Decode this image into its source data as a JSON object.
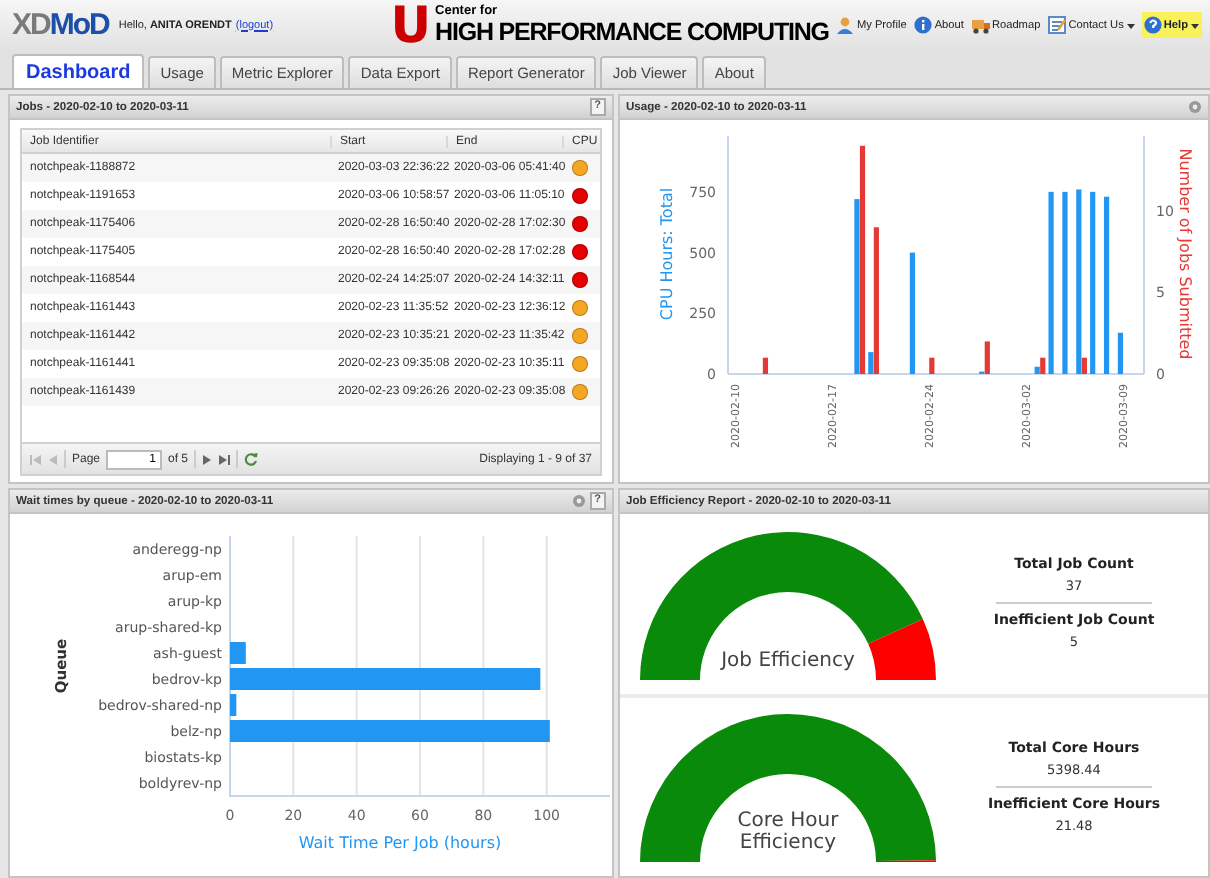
{
  "header": {
    "logo": {
      "part_1": "XD",
      "part_2": "MoD"
    },
    "greeting": "Hello, **ANITA ORENDT**",
    "logout": "(logout)",
    "center_logo": {
      "mark": "U",
      "line_1": "Center for",
      "line_2": "HIGH PERFORMANCE COMPUTING"
    },
    "toolbar": [
      {
        "label": "My Profile",
        "kind": "profile",
        "dropdown": false,
        "highlighted": false
      },
      {
        "label": "About",
        "kind": "info",
        "dropdown": false,
        "highlighted": false
      },
      {
        "label": "Roadmap",
        "kind": "truck",
        "dropdown": false,
        "highlighted": false
      },
      {
        "label": "Contact Us",
        "kind": "form",
        "dropdown": true,
        "highlighted": false
      },
      {
        "label": "Help",
        "kind": "help",
        "dropdown": true,
        "highlighted": true
      }
    ]
  },
  "tabs": [
    {
      "label": "Dashboard",
      "selected": true
    },
    {
      "label": "Usage",
      "selected": false
    },
    {
      "label": "Metric Explorer",
      "selected": false
    },
    {
      "label": "Data Export",
      "selected": false
    },
    {
      "label": "Report Generator",
      "selected": false
    },
    {
      "label": "Job Viewer",
      "selected": false
    },
    {
      "label": "About",
      "selected": false
    }
  ],
  "jobs_panel": {
    "title": "Jobs - 2020-02-10 to 2020-03-11",
    "help": "?",
    "columns": [
      "Job Identifier",
      "Start",
      "End",
      "CPU"
    ],
    "rows": [
      {
        "job": "notchpeak-1188872",
        "start": "2020-03-03 22:36:22",
        "end": "2020-03-06 05:41:40",
        "color": "#f5a623"
      },
      {
        "job": "notchpeak-1191653",
        "start": "2020-03-06 10:58:57",
        "end": "2020-03-06 11:05:10",
        "color": "#e60000"
      },
      {
        "job": "notchpeak-1175406",
        "start": "2020-02-28 16:50:40",
        "end": "2020-02-28 17:02:30",
        "color": "#e60000"
      },
      {
        "job": "notchpeak-1175405",
        "start": "2020-02-28 16:50:40",
        "end": "2020-02-28 17:02:28",
        "color": "#e60000"
      },
      {
        "job": "notchpeak-1168544",
        "start": "2020-02-24 14:25:07",
        "end": "2020-02-24 14:32:11",
        "color": "#e60000"
      },
      {
        "job": "notchpeak-1161443",
        "start": "2020-02-23 11:35:52",
        "end": "2020-02-23 12:36:12",
        "color": "#f5a623"
      },
      {
        "job": "notchpeak-1161442",
        "start": "2020-02-23 10:35:21",
        "end": "2020-02-23 11:35:42",
        "color": "#f5a623"
      },
      {
        "job": "notchpeak-1161441",
        "start": "2020-02-23 09:35:08",
        "end": "2020-02-23 10:35:11",
        "color": "#f5a623"
      },
      {
        "job": "notchpeak-1161439",
        "start": "2020-02-23 09:26:26",
        "end": "2020-02-23 09:35:08",
        "color": "#f5a623"
      }
    ],
    "pager": {
      "page_label": "Page",
      "page": "1",
      "of": "of 5",
      "displaying": "Displaying 1 - 9 of 37"
    }
  },
  "usage_panel": {
    "title": "Usage - 2020-02-10 to 2020-03-11",
    "chart_data": {
      "type": "bar",
      "categories": [
        "2020-02-10",
        null,
        null,
        null,
        null,
        null,
        null,
        "2020-02-17",
        null,
        null,
        null,
        null,
        null,
        null,
        "2020-02-24",
        null,
        null,
        null,
        null,
        null,
        null,
        "2020-03-02",
        null,
        null,
        null,
        null,
        null,
        null,
        "2020-03-09",
        null
      ],
      "ylim": [
        0,
        980
      ],
      "yticks": [
        0,
        250,
        500,
        750
      ],
      "y2lim": [
        0,
        14.6
      ],
      "y2ticks": [
        0,
        5,
        10
      ],
      "stacked": false,
      "series": [
        {
          "name": "CPU Hours: Total",
          "color": "#2196f3",
          "values": [
            null,
            null,
            null,
            null,
            null,
            null,
            null,
            null,
            null,
            720,
            90,
            null,
            null,
            500,
            null,
            null,
            null,
            null,
            10,
            null,
            null,
            null,
            30,
            750,
            750,
            760,
            750,
            730,
            170,
            null
          ]
        },
        {
          "name": "Number of Jobs Submitted",
          "color": "#e53935",
          "axis": "y2",
          "values": [
            null,
            null,
            1,
            null,
            null,
            null,
            null,
            null,
            null,
            14,
            9,
            null,
            null,
            null,
            1,
            null,
            null,
            null,
            2,
            null,
            null,
            null,
            1,
            null,
            null,
            1,
            null,
            null,
            null,
            null
          ]
        }
      ]
    }
  },
  "wait_panel": {
    "title": "Wait times by queue - 2020-02-10 to 2020-03-11",
    "help": "?",
    "chart_data": {
      "type": "bar",
      "orientation": "horizontal",
      "ylabel": "Queue",
      "categories": [
        "anderegg-np",
        "arup-em",
        "arup-kp",
        "arup-shared-kp",
        "ash-guest",
        "bedrov-kp",
        "bedrov-shared-np",
        "belz-np",
        "biostats-kp",
        "boldyrev-np"
      ],
      "xlim": [
        0,
        120
      ],
      "xticks": [
        0,
        20,
        40,
        60,
        80,
        100
      ],
      "grid": true,
      "series": [
        {
          "name": "Wait Time Per Job (hours)",
          "color": "#2196f3",
          "values": [
            null,
            null,
            null,
            null,
            5,
            98,
            2,
            101,
            null,
            null
          ]
        }
      ]
    }
  },
  "efficiency_panel": {
    "title": "Job Efficiency Report - 2020-02-10 to 2020-03-11",
    "gauges": [
      {
        "label": "Job Efficiency",
        "level": 0.865,
        "stats": [
          {
            "label": "Total Job Count",
            "value": "37"
          },
          {
            "label": "Inefficient Job Count",
            "value": "5"
          }
        ]
      },
      {
        "label": "Core Hour Efficiency",
        "level": 0.996,
        "stats": [
          {
            "label": "Total Core Hours",
            "value": "5398.44"
          },
          {
            "label": "Inefficient Core Hours",
            "value": "21.48"
          }
        ]
      }
    ]
  }
}
